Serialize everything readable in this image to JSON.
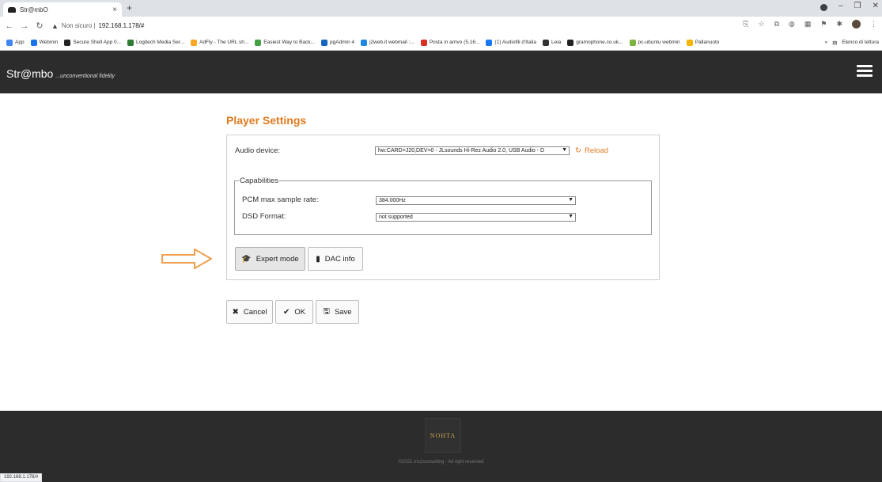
{
  "browser": {
    "tab_title": "Str@mbO",
    "tab_close": "×",
    "new_tab": "+",
    "security_label": "Non sicuro",
    "url": "192.168.1.178/#",
    "status_url": "192.168.1.178/#",
    "bookmarks": [
      {
        "label": "App",
        "color": "#4285f4"
      },
      {
        "label": "Webmin",
        "color": "#1a73e8"
      },
      {
        "label": "Secure Shell App 0...",
        "color": "#222222"
      },
      {
        "label": "Logitech Media Ser...",
        "color": "#2e7d32"
      },
      {
        "label": "AdFly - The URL sh...",
        "color": "#f9a825"
      },
      {
        "label": "Easiest Way to Back...",
        "color": "#43a047"
      },
      {
        "label": "pgAdmin 4",
        "color": "#1565c0"
      },
      {
        "label": "j2web.it webmail :...",
        "color": "#1e88e5"
      },
      {
        "label": "Posta in arrivo (5.16...",
        "color": "#d93025"
      },
      {
        "label": "(1) Audiofili d'Italia",
        "color": "#1877f2"
      },
      {
        "label": "Leia",
        "color": "#333333"
      },
      {
        "label": "gramophone.co.uk...",
        "color": "#222222"
      },
      {
        "label": "pc-ubuntu webmin",
        "color": "#7cb342"
      },
      {
        "label": "Pallanuoto",
        "color": "#f4b400"
      }
    ],
    "bookmarks_more": "»",
    "reading_list": "Elenco di lettura"
  },
  "app": {
    "brand": "Str@mbo",
    "tagline": "...unconventional fidelity"
  },
  "settings": {
    "title": "Player Settings",
    "audio_device_label": "Audio device:",
    "audio_device_value": "hw:CARD=J20,DEV=0 - JLsounds Hi-Rez Audio 2.0, USB Audio - D",
    "reload_label": "Reload",
    "capabilities_legend": "Capabilities",
    "pcm_label": "PCM max sample rate:",
    "pcm_value": "384.000Hz",
    "dsd_label": "DSD Format:",
    "dsd_value": "not supported",
    "expert_mode_label": "Expert mode",
    "dac_info_label": "DAC info"
  },
  "actions": {
    "cancel_label": "Cancel",
    "ok_label": "OK",
    "save_label": "Save"
  },
  "footer": {
    "logo": "NOHTA",
    "copyright": "©2021 mc2consulting - All right reserved"
  },
  "colors": {
    "accent": "#e07b20",
    "navbar": "#2c2c2c"
  }
}
